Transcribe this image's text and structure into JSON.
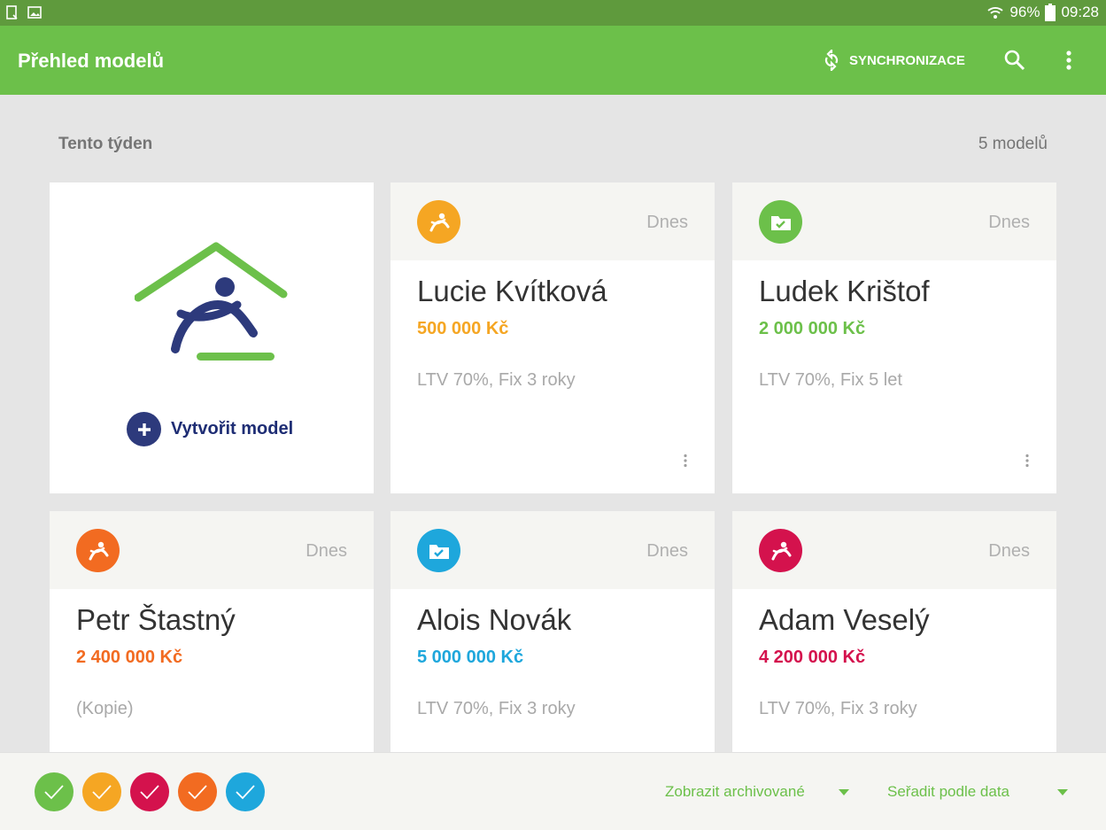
{
  "status_bar": {
    "battery": "96%",
    "time": "09:28"
  },
  "app_bar": {
    "title": "Přehled modelů",
    "sync_label": "SYNCHRONIZACE"
  },
  "section": {
    "title": "Tento týden",
    "count": "5 modelů"
  },
  "create_card": {
    "label": "Vytvořit model"
  },
  "models": [
    {
      "name": "Lucie Kvítková",
      "amount": "500 000 Kč",
      "desc": "LTV 70%, Fix 3 roky",
      "date": "Dnes",
      "color": "#f5a623",
      "icon": "person-icon"
    },
    {
      "name": "Ludek Krištof",
      "amount": "2 000 000 Kč",
      "desc": "LTV 70%, Fix 5 let",
      "date": "Dnes",
      "color": "#6cc04a",
      "icon": "folder-check-icon"
    },
    {
      "name": "Petr Štastný",
      "amount": "2 400 000 Kč",
      "desc": "(Kopie)",
      "date": "Dnes",
      "color": "#f26b21",
      "icon": "person-icon"
    },
    {
      "name": "Alois Novák",
      "amount": "5 000 000 Kč",
      "desc": "LTV 70%, Fix 3 roky",
      "date": "Dnes",
      "color": "#1ea7dc",
      "icon": "folder-check-icon"
    },
    {
      "name": "Adam Veselý",
      "amount": "4 200 000 Kč",
      "desc": "LTV 70%, Fix 3 roky",
      "date": "Dnes",
      "color": "#d4124d",
      "icon": "person-icon"
    }
  ],
  "bottom_bar": {
    "filter_colors": [
      "#6cc04a",
      "#f5a623",
      "#d4124d",
      "#f26b21",
      "#1ea7dc"
    ],
    "archived_label": "Zobrazit archivované",
    "sort_label": "Seřadit podle data"
  }
}
